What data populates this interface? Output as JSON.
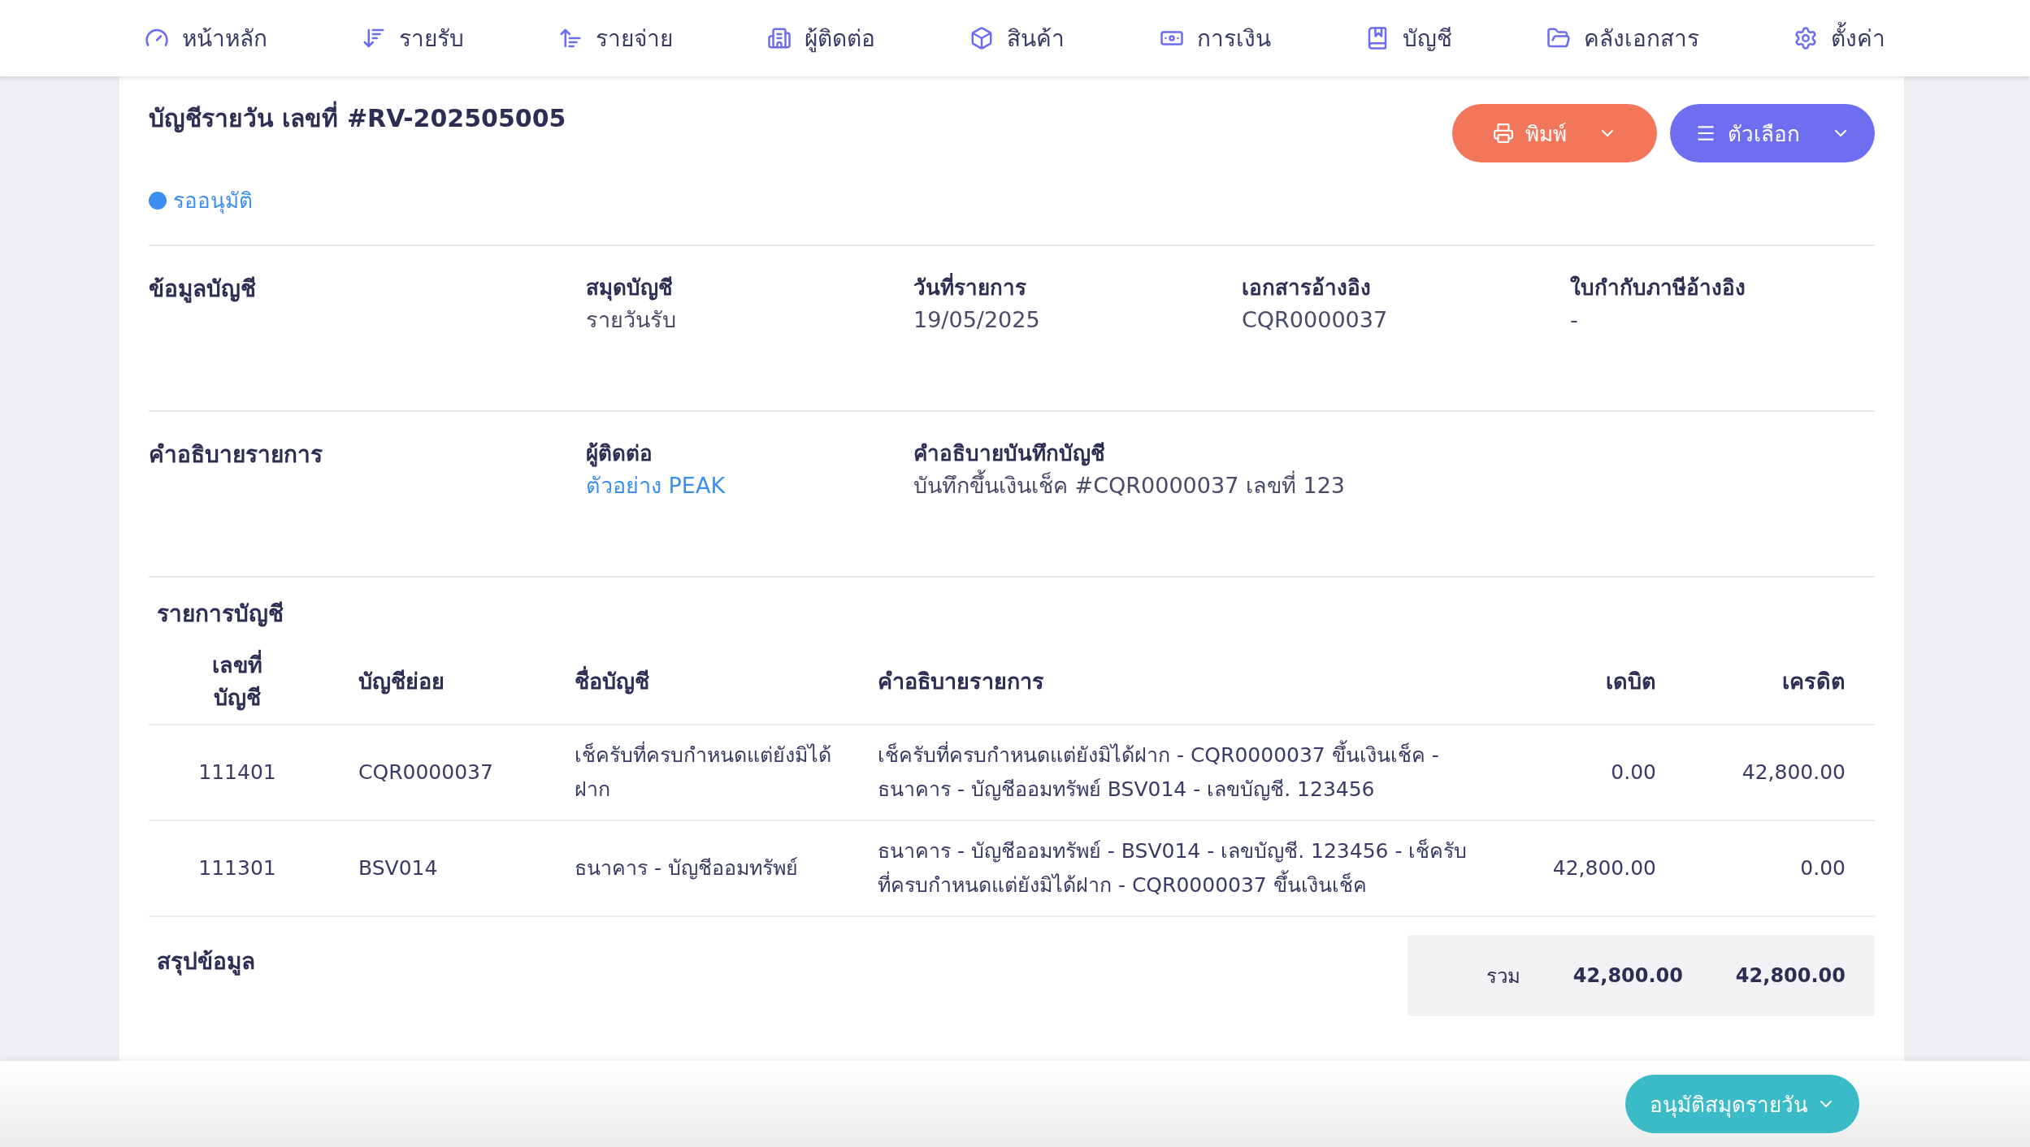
{
  "nav": [
    {
      "kind": "home",
      "label": "หน้าหลัก"
    },
    {
      "kind": "income",
      "label": "รายรับ"
    },
    {
      "kind": "expense",
      "label": "รายจ่าย"
    },
    {
      "kind": "contacts",
      "label": "ผู้ติดต่อ"
    },
    {
      "kind": "products",
      "label": "สินค้า"
    },
    {
      "kind": "finance",
      "label": "การเงิน"
    },
    {
      "kind": "accounts",
      "label": "บัญชี"
    },
    {
      "kind": "documents",
      "label": "คลังเอกสาร"
    },
    {
      "kind": "settings",
      "label": "ตั้งค่า"
    }
  ],
  "title": "บัญชีรายวัน เลขที่ #RV-202505005",
  "buttons": [
    {
      "kind": "print",
      "label": "พิมพ์"
    },
    {
      "kind": "options",
      "label": "ตัวเลือก"
    }
  ],
  "status": {
    "label": "รออนุมัติ",
    "color": "#3b8ff0"
  },
  "sections": [
    {
      "title": "ข้อมูลบัญชี",
      "fields": [
        {
          "label": "สมุดบัญชี",
          "value": "รายวันรับ"
        },
        {
          "label": "วันที่รายการ",
          "value": "19/05/2025"
        },
        {
          "label": "เอกสารอ้างอิง",
          "value": "CQR0000037"
        },
        {
          "label": "ใบกำกับภาษีอ้างอิง",
          "value": "-"
        }
      ]
    },
    {
      "title": "คำอธิบายรายการ",
      "fields": [
        {
          "label": "ผู้ติดต่อ",
          "value": "ตัวอย่าง PEAK",
          "link": true
        },
        {
          "label": "คำอธิบายบันทึกบัญชี",
          "value": "บันทึกขึ้นเงินเช็ค #CQR0000037 เลขที่ 123"
        }
      ]
    }
  ],
  "table": {
    "title": "รายการบัญชี",
    "columns": [
      "เลขที่\nบัญชี",
      "บัญชีย่อย",
      "ชื่อบัญชี",
      "คำอธิบายรายการ",
      "เดบิต",
      "เครดิต"
    ],
    "rows": [
      [
        "111401",
        "CQR0000037",
        "เช็ครับที่ครบกำหนดแต่ยังมิได้ฝาก",
        "เช็ครับที่ครบกำหนดแต่ยังมิได้ฝาก - CQR0000037 ขึ้นเงินเช็ค - ธนาคาร - บัญชีออมทรัพย์ BSV014 - เลขบัญชี. 123456",
        "0.00",
        "42,800.00"
      ],
      [
        "111301",
        "BSV014",
        "ธนาคาร - บัญชีออมทรัพย์",
        "ธนาคาร - บัญชีออมทรัพย์ - BSV014 - เลขบัญชี. 123456 - เช็ครับที่ครบกำหนดแต่ยังมิได้ฝาก - CQR0000037 ขึ้นเงินเช็ค",
        "42,800.00",
        "0.00"
      ]
    ]
  },
  "summary": {
    "title": "สรุปข้อมูล",
    "total_label": "รวม",
    "debit": "42,800.00",
    "credit": "42,800.00"
  },
  "footer": {
    "approve_label": "อนุมัติสมุดรายวัน"
  }
}
